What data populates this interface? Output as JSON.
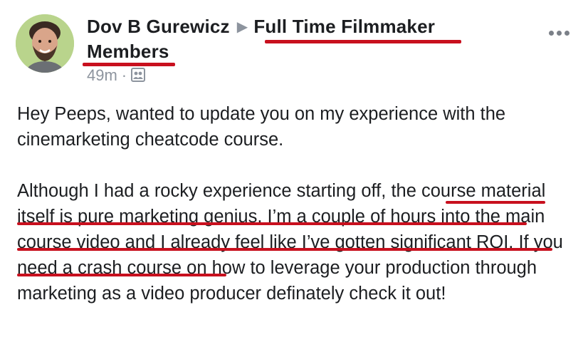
{
  "post": {
    "author": "Dov B Gurewicz",
    "separator": "▶",
    "group_line1": "Full Time Filmmaker",
    "group_line2": "Members",
    "time": "49m",
    "dot": "·",
    "audience_icon": "group-audience-icon",
    "more_icon": "more-options-icon",
    "paragraph1": "Hey Peeps, wanted to update you on my experience with the cinemarketing cheatcode course.",
    "paragraph2_part1": "Although I had a rocky experience starting off, ",
    "paragraph2_highlight": "the course material itself is pure marketing genius. I’m a couple of hours into the main course video and I already feel like I’ve gotten significant ROI.",
    "paragraph2_part2": " If you need a crash course on how to leverage your production through marketing as a video producer definately check it out!"
  },
  "colors": {
    "text": "#1c1e21",
    "meta": "#8d949e",
    "annotation_underline": "#c8101e",
    "avatar_background": "#b9d48c"
  }
}
